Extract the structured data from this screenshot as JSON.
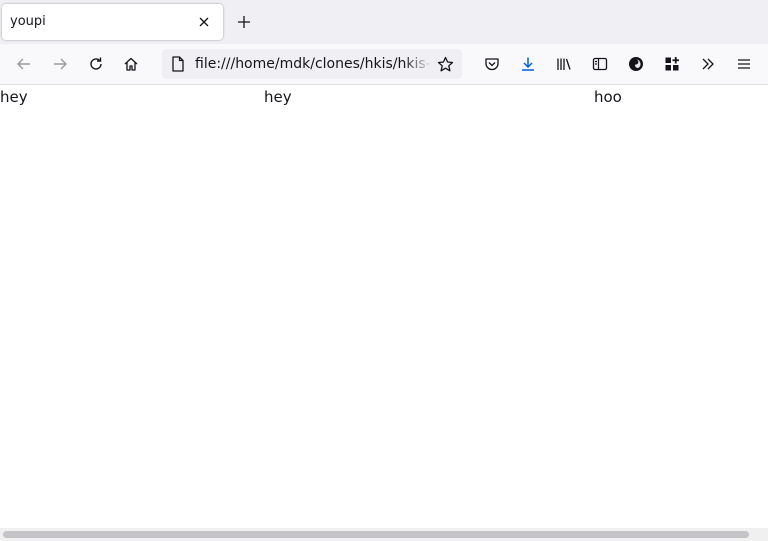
{
  "window": {
    "tabs": [
      {
        "title": "youpi",
        "active": true
      }
    ]
  },
  "toolbar": {
    "url": "file:///home/mdk/clones/hkis/hkis-website/tables.html",
    "icons": {
      "back": "back-arrow-icon",
      "forward": "forward-arrow-icon",
      "reload": "reload-icon",
      "home": "home-icon",
      "page": "page-icon",
      "bookmark": "star-icon",
      "pocket": "pocket-icon",
      "downloads": "download-icon",
      "library": "library-icon",
      "sidebar": "sidebar-icon",
      "account": "account-icon",
      "extensions": "extensions-icon",
      "overflow": "overflow-chevrons-icon",
      "menu": "hamburger-menu-icon"
    }
  },
  "page": {
    "row": [
      "hey",
      "hey",
      "hoo"
    ]
  },
  "colors": {
    "tabstrip": "#f0f0f4",
    "toolbar": "#f9f9fb",
    "urlbar": "#f0f0f4",
    "download_accent": "#0061e0",
    "text": "#15141a"
  }
}
